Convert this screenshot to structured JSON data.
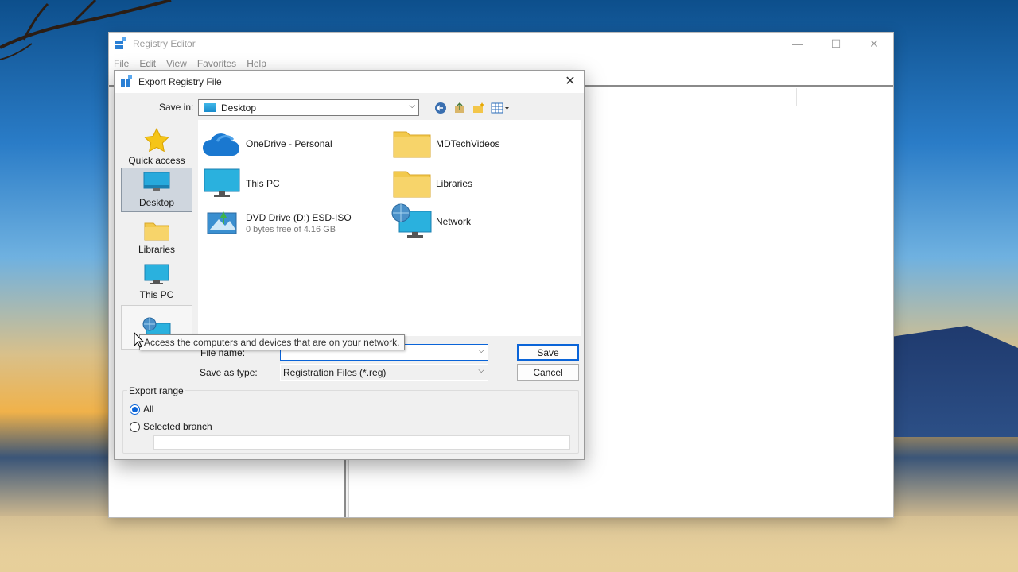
{
  "registry_window": {
    "title": "Registry Editor",
    "menu": [
      "File",
      "Edit",
      "View",
      "Favorites",
      "Help"
    ],
    "controls": {
      "minimize": "—",
      "maximize": "☐",
      "close": "✕"
    }
  },
  "dialog": {
    "title": "Export Registry File",
    "close": "✕",
    "save_in_label": "Save in:",
    "save_in_value": "Desktop",
    "places": [
      {
        "label": "Quick access",
        "icon": "star-icon"
      },
      {
        "label": "Desktop",
        "icon": "desktop-icon",
        "selected": true
      },
      {
        "label": "Libraries",
        "icon": "folder-icon"
      },
      {
        "label": "This PC",
        "icon": "monitor-icon"
      },
      {
        "label": "Network",
        "icon": "network-icon"
      }
    ],
    "items": [
      {
        "name": "OneDrive - Personal",
        "icon": "cloud-icon"
      },
      {
        "name": "MDTechVideos",
        "icon": "folder-icon"
      },
      {
        "name": "This PC",
        "icon": "monitor-icon"
      },
      {
        "name": "Libraries",
        "icon": "folder-icon"
      },
      {
        "name": "DVD Drive (D:) ESD-ISO",
        "sub": "0 bytes free of 4.16 GB",
        "icon": "dvd-icon"
      },
      {
        "name": "Network",
        "icon": "network-icon"
      }
    ],
    "tooltip": "Access the computers and devices that are on your network.",
    "file_name_label": "File name:",
    "file_name_value": "",
    "save_as_type_label": "Save as type:",
    "save_as_type_value": "Registration Files (*.reg)",
    "save_button": "Save",
    "cancel_button": "Cancel",
    "export_range": {
      "title": "Export range",
      "options": [
        "All",
        "Selected branch"
      ],
      "selected": "All",
      "branch_value": ""
    }
  },
  "colors": {
    "accent": "#0a64d8",
    "selected_place": "#cfd6de"
  }
}
